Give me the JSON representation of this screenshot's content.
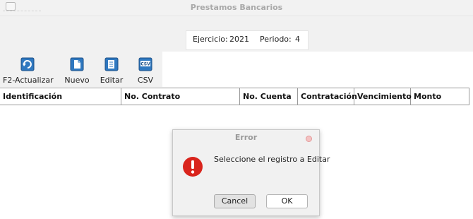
{
  "window": {
    "title": "Prestamos Bancarios"
  },
  "filters": {
    "ejercicio_label": "Ejercicio:",
    "ejercicio_value": "2021",
    "periodo_label": "Periodo:",
    "periodo_value": "4"
  },
  "toolbar": {
    "refresh_label": "F2-Actualizar",
    "new_label": "Nuevo",
    "edit_label": "Editar",
    "csv_label": "CSV",
    "refresh_icon": "refresh-icon",
    "new_icon": "new-document-icon",
    "edit_icon": "edit-document-icon",
    "csv_icon": "csv-file-icon",
    "csv_icon_text": "CSV"
  },
  "table": {
    "columns": [
      "Identificación",
      "No. Contrato",
      "No. Cuenta",
      "Contratación",
      "Vencimiento",
      "Monto"
    ],
    "rows": []
  },
  "dialog": {
    "title": "Error",
    "message": "Seleccione el registro a Editar",
    "cancel_label": "Cancel",
    "ok_label": "OK",
    "icon": "error-exclamation-icon"
  },
  "colors": {
    "error_red": "#d9241c",
    "toolbar_icon_blue": "#2f78c0"
  }
}
